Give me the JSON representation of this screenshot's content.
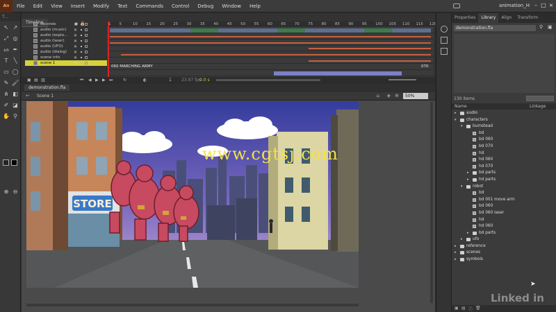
{
  "app": {
    "logo": "An",
    "menus": [
      "File",
      "Edit",
      "View",
      "Insert",
      "Modify",
      "Text",
      "Commands",
      "Control",
      "Debug",
      "Window",
      "Help"
    ],
    "workspace": "animation_H"
  },
  "toolbar": {
    "header": "T...",
    "tools": [
      "selection-tool-icon",
      "subselection-tool-icon",
      "free-transform-icon",
      "3d-rotation-icon",
      "lasso-icon",
      "pen-icon",
      "text-icon",
      "line-icon",
      "rectangle-icon",
      "oval-icon",
      "pencil-icon",
      "brush-icon",
      "bone-icon",
      "paint-bucket-icon",
      "eyedropper-icon",
      "eraser-icon",
      "hand-icon",
      "zoom-icon"
    ]
  },
  "timeline": {
    "tab": "Timeline",
    "ruler": [
      "1",
      "5",
      "10",
      "15",
      "20",
      "25",
      "30",
      "35",
      "40",
      "45",
      "50",
      "55",
      "60",
      "65",
      "70",
      "75",
      "80",
      "85",
      "90",
      "95",
      "100",
      "105",
      "110",
      "115",
      "120"
    ],
    "layers": [
      {
        "name": "seconds"
      },
      {
        "name": "audio (music)"
      },
      {
        "name": "audio (explo..."
      },
      {
        "name": "audio (laser)"
      },
      {
        "name": "audio (UFO)"
      },
      {
        "name": "audio (dialog)"
      },
      {
        "name": "scene info"
      },
      {
        "name": "scene 1"
      }
    ],
    "frame_label": "060 MARCHING ARMY",
    "frame_end": "070",
    "controls": {
      "frame": "1",
      "fps": "23.97 fps",
      "time": "0.0 s"
    }
  },
  "document": {
    "tab": "demonstration.fla",
    "scene": "Scene 1",
    "zoom": "50%"
  },
  "watermark": "www.cgtsj.com",
  "library": {
    "tabs": [
      "Properties",
      "Library",
      "Align",
      "Transform"
    ],
    "file": "demonstration.fla",
    "count": "130 items",
    "col_name": "Name",
    "col_linkage": "Linkage",
    "tree": [
      {
        "label": "audio",
        "depth": 0,
        "type": "folder",
        "arrow": "▸"
      },
      {
        "label": "characters",
        "depth": 0,
        "type": "folder",
        "arrow": "▾"
      },
      {
        "label": "bumstead",
        "depth": 1,
        "type": "folder",
        "arrow": "▾"
      },
      {
        "label": "bd",
        "depth": 2,
        "type": "sym",
        "arrow": ""
      },
      {
        "label": "bd 060",
        "depth": 2,
        "type": "sym",
        "arrow": ""
      },
      {
        "label": "bd 070",
        "depth": 2,
        "type": "sym",
        "arrow": ""
      },
      {
        "label": "hd",
        "depth": 2,
        "type": "sym",
        "arrow": ""
      },
      {
        "label": "hd 060",
        "depth": 2,
        "type": "sym",
        "arrow": ""
      },
      {
        "label": "hd 070",
        "depth": 2,
        "type": "sym",
        "arrow": ""
      },
      {
        "label": "bd parts",
        "depth": 2,
        "type": "folder",
        "arrow": "▸"
      },
      {
        "label": "hd parts",
        "depth": 2,
        "type": "folder",
        "arrow": "▸"
      },
      {
        "label": "robot",
        "depth": 1,
        "type": "folder",
        "arrow": "▾"
      },
      {
        "label": "bd",
        "depth": 2,
        "type": "sym",
        "arrow": ""
      },
      {
        "label": "bd 001 move arm",
        "depth": 2,
        "type": "sym",
        "arrow": ""
      },
      {
        "label": "bd 060",
        "depth": 2,
        "type": "sym",
        "arrow": ""
      },
      {
        "label": "bd 060 laser",
        "depth": 2,
        "type": "sym",
        "arrow": ""
      },
      {
        "label": "hd",
        "depth": 2,
        "type": "sym",
        "arrow": ""
      },
      {
        "label": "hd 060",
        "depth": 2,
        "type": "sym",
        "arrow": ""
      },
      {
        "label": "bd parts",
        "depth": 2,
        "type": "folder",
        "arrow": "▸"
      },
      {
        "label": "ufo",
        "depth": 1,
        "type": "folder",
        "arrow": "▸"
      },
      {
        "label": "reference",
        "depth": 0,
        "type": "folder",
        "arrow": "▸"
      },
      {
        "label": "scenes",
        "depth": 0,
        "type": "folder",
        "arrow": "▸"
      },
      {
        "label": "symbols",
        "depth": 0,
        "type": "folder",
        "arrow": "▸"
      }
    ]
  },
  "stage": {
    "sign": "STORE"
  },
  "brand": "Linked in",
  "colors": {
    "playhead": "#d8232a",
    "selected_layer": "#d6d23a",
    "watermark": "#f3e24a"
  }
}
